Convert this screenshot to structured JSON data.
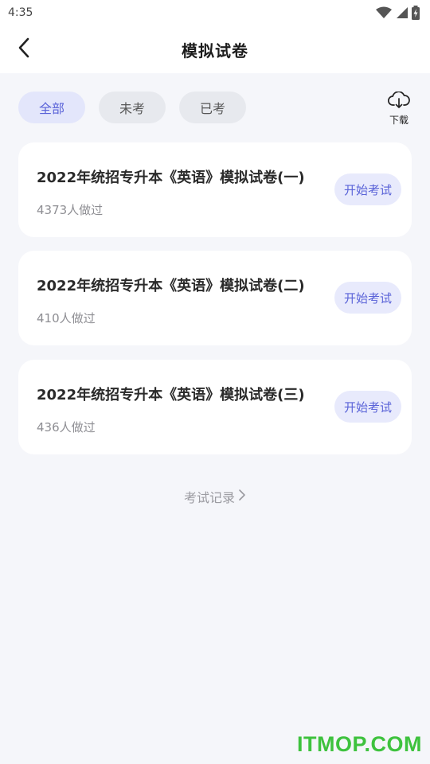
{
  "status_bar": {
    "time": "4:35",
    "icons": [
      "wifi-icon",
      "signal-icon",
      "battery-icon"
    ]
  },
  "nav": {
    "back_icon": "chevron-left-icon",
    "title": "模拟试卷"
  },
  "filters": {
    "tabs": [
      {
        "label": "全部",
        "active": true
      },
      {
        "label": "未考",
        "active": false
      },
      {
        "label": "已考",
        "active": false
      }
    ],
    "download_label": "下载",
    "download_icon": "cloud-download-icon"
  },
  "papers": [
    {
      "title": "2022年统招专升本《英语》模拟试卷(一)",
      "count": "4373人做过",
      "action": "开始考试"
    },
    {
      "title": "2022年统招专升本《英语》模拟试卷(二)",
      "count": "410人做过",
      "action": "开始考试"
    },
    {
      "title": "2022年统招专升本《英语》模拟试卷(三)",
      "count": "436人做过",
      "action": "开始考试"
    }
  ],
  "records": {
    "label": "考试记录",
    "icon": "chevron-right-icon"
  },
  "watermark": "ITMOP.COM",
  "colors": {
    "accent": "#5a63d8",
    "accent_bg": "#e3e6fb",
    "page_bg": "#f5f6fa",
    "watermark": "#3ec23e"
  }
}
